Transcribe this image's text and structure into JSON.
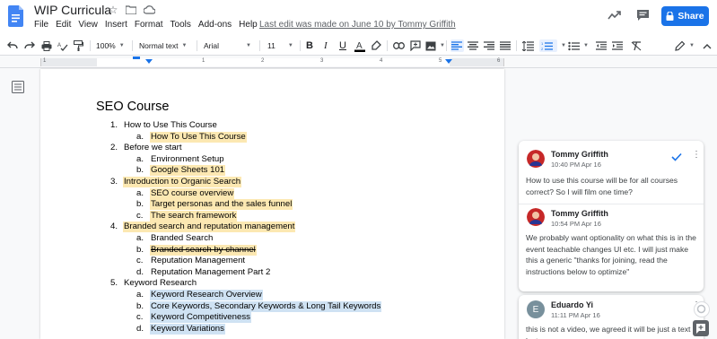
{
  "doc": {
    "title": "WIP Curricula",
    "menu": [
      "File",
      "Edit",
      "View",
      "Insert",
      "Format",
      "Tools",
      "Add-ons",
      "Help"
    ],
    "last_edit": "Last edit was made on June 10 by Tommy Griffith",
    "share_label": "Share"
  },
  "toolbar": {
    "zoom": "100%",
    "style": "Normal text",
    "font": "Arial",
    "size": "11"
  },
  "ruler": {
    "numbers": [
      "1",
      "1",
      "2",
      "3",
      "4",
      "5",
      "6"
    ]
  },
  "content": {
    "heading": "SEO Course",
    "lines": [
      {
        "marker": "1.",
        "text": "How to Use This Course",
        "level": 1,
        "highlight": "",
        "strike": false
      },
      {
        "marker": "a.",
        "text": "How To Use This Course",
        "level": 2,
        "highlight": "#fce8b2",
        "strike": false
      },
      {
        "marker": "2.",
        "text": "Before we start",
        "level": 1,
        "highlight": "",
        "strike": false
      },
      {
        "marker": "a.",
        "text": "Environment Setup",
        "level": 2,
        "highlight": "",
        "strike": false
      },
      {
        "marker": "b.",
        "text": "Google Sheets 101",
        "level": 2,
        "highlight": "#fce8b2",
        "strike": false
      },
      {
        "marker": "3.",
        "text": "Introduction to Organic Search",
        "level": 1,
        "highlight": "#fce8b2",
        "strike": false
      },
      {
        "marker": "a.",
        "text": "SEO course overview",
        "level": 2,
        "highlight": "#fce8b2",
        "strike": false
      },
      {
        "marker": "b.",
        "text": "Target personas and the sales funnel",
        "level": 2,
        "highlight": "#fce8b2",
        "strike": false
      },
      {
        "marker": "c.",
        "text": "The search framework",
        "level": 2,
        "highlight": "#fce8b2",
        "strike": false
      },
      {
        "marker": "4.",
        "text": "Branded search and reputation management",
        "level": 1,
        "highlight": "#fce8b2",
        "strike": false
      },
      {
        "marker": "a.",
        "text": "Branded Search",
        "level": 2,
        "highlight": "",
        "strike": false
      },
      {
        "marker": "b.",
        "text": "Branded search by channel",
        "level": 2,
        "highlight": "#fce8b2",
        "strike": true
      },
      {
        "marker": "c.",
        "text": "Reputation Management",
        "level": 2,
        "highlight": "",
        "strike": false
      },
      {
        "marker": "d.",
        "text": "Reputation Management Part 2",
        "level": 2,
        "highlight": "",
        "strike": false
      },
      {
        "marker": "5.",
        "text": "Keyword Research",
        "level": 1,
        "highlight": "",
        "strike": false
      },
      {
        "marker": "a.",
        "text": "Keyword Research Overview",
        "level": 2,
        "highlight": "#cfe2f3",
        "strike": false
      },
      {
        "marker": "b.",
        "text": "Core Keywords, Secondary Keywords & Long Tail Keywords",
        "level": 2,
        "highlight": "#cfe2f3",
        "strike": false
      },
      {
        "marker": "c.",
        "text": "Keyword Competitiveness",
        "level": 2,
        "highlight": "#cfe2f3",
        "strike": false
      },
      {
        "marker": "d.",
        "text": "Keyword Variations",
        "level": 2,
        "highlight": "#cfe2f3",
        "strike": false
      }
    ]
  },
  "comments": [
    {
      "entries": [
        {
          "author": "Tommy Griffith",
          "time": "10:40 PM Apr 16",
          "text": "How to use this course will be for all courses correct? So I will film one time?"
        },
        {
          "author": "Tommy Griffith",
          "time": "10:54 PM Apr 16",
          "text": "We probably want optionality on what this is in the event teachable changes UI etc. I will just make this a generic \"thanks for joining, read the instructions below to optimize\""
        }
      ]
    },
    {
      "entries": [
        {
          "author": "Eduardo Yi",
          "time": "11:11 PM Apr 16",
          "initial": "E",
          "text": "this is not a video, we agreed it will be just a text lecture"
        }
      ]
    }
  ],
  "colors": {
    "accent": "#1a73e8",
    "highlight_yellow": "#fce8b2",
    "highlight_blue": "#cfe2f3",
    "avatar_grey": "#78909c"
  }
}
